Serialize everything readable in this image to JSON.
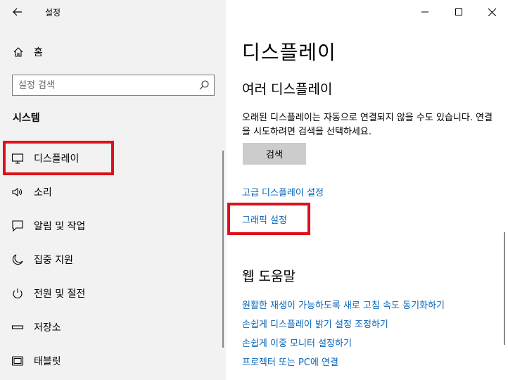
{
  "window": {
    "title": "설정",
    "controls": [
      "minimize",
      "maximize",
      "close"
    ]
  },
  "sidebar": {
    "home_label": "홈",
    "search_placeholder": "설정 검색",
    "section_title": "시스템",
    "items": [
      {
        "label": "디스플레이",
        "icon": "monitor-icon",
        "selected": true
      },
      {
        "label": "소리",
        "icon": "speaker-icon"
      },
      {
        "label": "알림 및 작업",
        "icon": "notification-icon"
      },
      {
        "label": "집중 지원",
        "icon": "moon-icon"
      },
      {
        "label": "전원 및 절전",
        "icon": "power-icon"
      },
      {
        "label": "저장소",
        "icon": "storage-icon"
      },
      {
        "label": "태블릿",
        "icon": "tablet-icon"
      }
    ]
  },
  "main": {
    "title": "디스플레이",
    "multi_display": {
      "heading": "여러 디스플레이",
      "description": "오래된 디스플레이는 자동으로 연결되지 않을 수도 있습니다. 연결을 시도하려면 검색을 선택하세요.",
      "detect_button": "검색"
    },
    "links": {
      "advanced": "고급 디스플레이 설정",
      "graphics": "그래픽 설정"
    },
    "help": {
      "heading": "웹 도움말",
      "links": [
        "원활한 재생이 가능하도록 새로 고침 속도 동기화하기",
        "손쉽게 디스플레이 밝기 설정 조정하기",
        "손쉽게 이중 모니터 설정하기",
        "프로젝터 또는 PC에 연결"
      ]
    }
  },
  "colors": {
    "accent_link": "#0a66b8",
    "highlight_box": "#e0101a",
    "sidebar_bg": "#f2f2f2"
  }
}
